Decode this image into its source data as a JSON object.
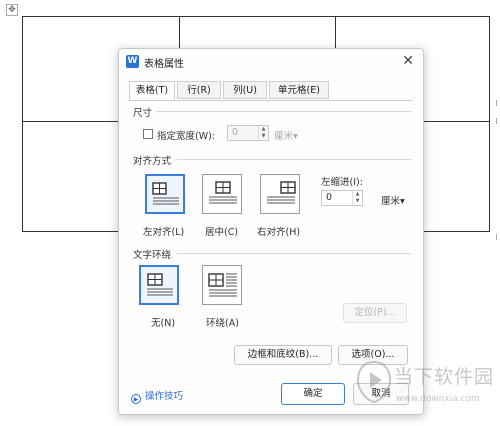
{
  "dialog": {
    "title": "表格属性",
    "close_symbol": "✕",
    "app_icon": "W"
  },
  "tabs": [
    {
      "label": "表格(T)",
      "active": true
    },
    {
      "label": "行(R)",
      "active": false
    },
    {
      "label": "列(U)",
      "active": false
    },
    {
      "label": "单元格(E)",
      "active": false
    }
  ],
  "size_section": {
    "label": "尺寸",
    "preferred_width_label": "指定宽度(W):",
    "preferred_width_checked": false,
    "width_value": "0",
    "unit": "厘米"
  },
  "alignment_section": {
    "label": "对齐方式",
    "options": [
      {
        "label": "左对齐(L)",
        "icon": "align-left-icon",
        "selected": true
      },
      {
        "label": "居中(C)",
        "icon": "align-center-icon",
        "selected": false
      },
      {
        "label": "右对齐(H)",
        "icon": "align-right-icon",
        "selected": false
      }
    ],
    "indent_label": "左缩进(I):",
    "indent_value": "0",
    "indent_unit": "厘米"
  },
  "wrap_section": {
    "label": "文字环绕",
    "options": [
      {
        "label": "无(N)",
        "icon": "wrap-none-icon",
        "selected": true
      },
      {
        "label": "环绕(A)",
        "icon": "wrap-around-icon",
        "selected": false
      }
    ],
    "position_button": "定位(P)..."
  },
  "buttons": {
    "borders_shading": "边框和底纹(B)...",
    "options": "选项(O)...",
    "ok": "确定",
    "cancel": "取消"
  },
  "tips_link": "操作技巧",
  "watermark": {
    "text": "当下软件园",
    "url": "www.downxia.com"
  },
  "colors": {
    "accent": "#3b7ddd",
    "app_icon_bg": "#2b6fd6"
  }
}
